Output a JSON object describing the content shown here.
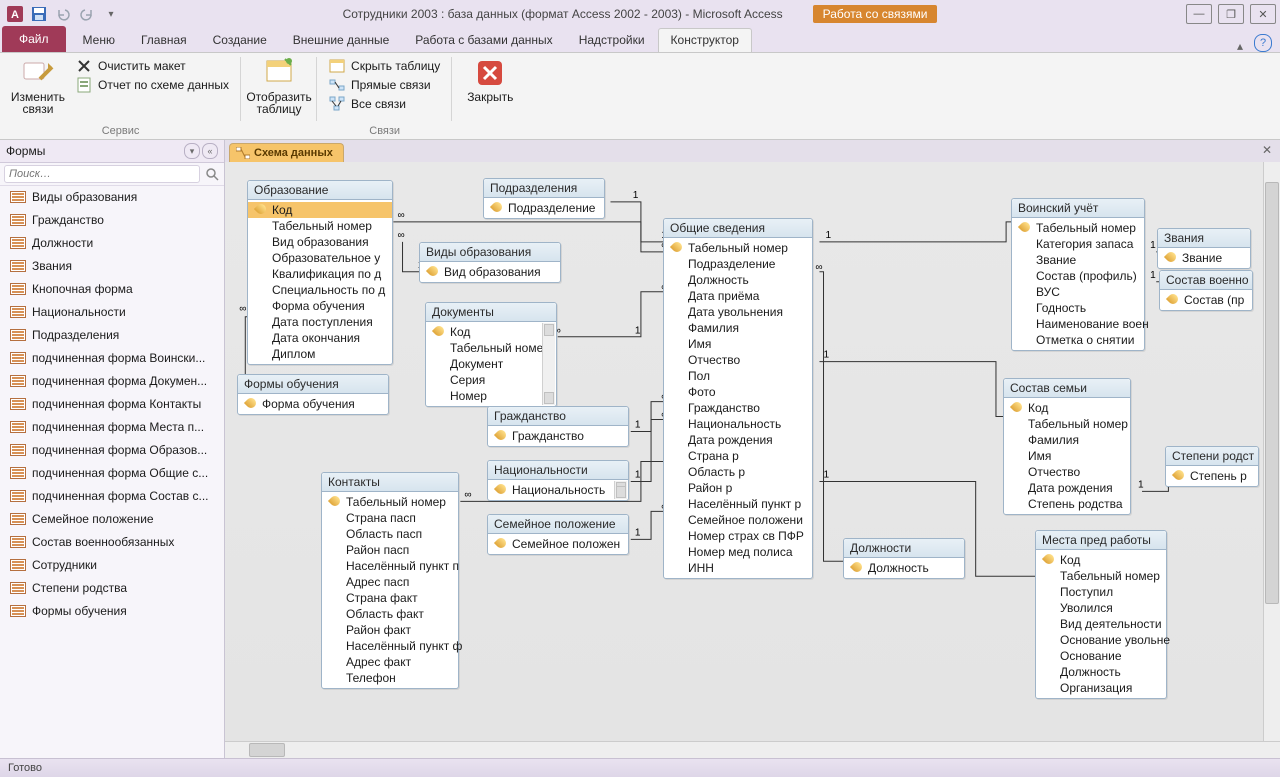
{
  "titlebar": {
    "title": "Сотрудники 2003 : база данных (формат Access 2002 - 2003)  -  Microsoft Access",
    "context_label": "Работа со связями"
  },
  "tabs": {
    "file": "Файл",
    "items": [
      "Меню",
      "Главная",
      "Создание",
      "Внешние данные",
      "Работа с базами данных",
      "Надстройки",
      "Конструктор"
    ],
    "active_index": 6
  },
  "ribbon": {
    "group1": {
      "title": "Сервис",
      "edit_rel": "Изменить связи",
      "clear_layout": "Очистить макет",
      "rel_report": "Отчет по схеме данных"
    },
    "group2": {
      "title": "",
      "show_table": "Отобразить таблицу"
    },
    "group3": {
      "title": "Связи",
      "hide_table": "Скрыть таблицу",
      "direct_rel": "Прямые связи",
      "all_rel": "Все связи"
    },
    "group4": {
      "close": "Закрыть"
    }
  },
  "nav": {
    "header": "Формы",
    "search_placeholder": "Поиск…",
    "items": [
      "Виды образования",
      "Гражданство",
      "Должности",
      "Звания",
      "Кнопочная форма",
      "Национальности",
      "Подразделения",
      "подчиненная форма Воински...",
      "подчиненная форма Докумен...",
      "подчиненная форма Контакты",
      "подчиненная форма Места п...",
      "подчиненная форма Образов...",
      "подчиненная форма Общие с...",
      "подчиненная форма Состав с...",
      "Семейное положение",
      "Состав военнообязанных",
      "Сотрудники",
      "Степени родства",
      "Формы обучения"
    ]
  },
  "doc_tab": {
    "label": "Схема данных"
  },
  "tables": {
    "edu": {
      "head": "Образование",
      "fields": [
        "Код",
        "Табельный номер",
        "Вид образования",
        "Образовательное у",
        "Квалификация по д",
        "Специальность по д",
        "Форма обучения",
        "Дата поступления",
        "Дата окончания",
        "Диплом"
      ],
      "pk": [
        0
      ],
      "sel": [
        0
      ]
    },
    "edu_kind": {
      "head": "Виды образования",
      "fields": [
        "Вид образования"
      ],
      "pk": [
        0
      ]
    },
    "docs": {
      "head": "Документы",
      "fields": [
        "Код",
        "Табельный номер",
        "Документ",
        "Серия",
        "Номер"
      ],
      "pk": [
        0
      ]
    },
    "edu_form": {
      "head": "Формы обучения",
      "fields": [
        "Форма обучения"
      ],
      "pk": [
        0
      ]
    },
    "citiz": {
      "head": "Гражданство",
      "fields": [
        "Гражданство"
      ],
      "pk": [
        0
      ]
    },
    "nation": {
      "head": "Национальности",
      "fields": [
        "Национальность"
      ],
      "pk": [
        0
      ]
    },
    "marital": {
      "head": "Семейное положение",
      "fields": [
        "Семейное положен"
      ],
      "pk": [
        0
      ]
    },
    "contacts": {
      "head": "Контакты",
      "fields": [
        "Табельный номер",
        "Страна пасп",
        "Область пасп",
        "Район пасп",
        "Населённый пункт п",
        "Адрес пасп",
        "Страна факт",
        "Область факт",
        "Район факт",
        "Населённый пункт ф",
        "Адрес факт",
        "Телефон"
      ],
      "pk": [
        0
      ]
    },
    "depts": {
      "head": "Подразделения",
      "fields": [
        "Подразделение"
      ],
      "pk": [
        0
      ]
    },
    "common": {
      "head": "Общие сведения",
      "fields": [
        "Табельный номер",
        "Подразделение",
        "Должность",
        "Дата приёма",
        "Дата увольнения",
        "Фамилия",
        "Имя",
        "Отчество",
        "Пол",
        "Фото",
        "Гражданство",
        "Национальность",
        "Дата рождения",
        "Страна р",
        "Область р",
        "Район р",
        "Населённый пункт р",
        "Семейное положени",
        "Номер страх св ПФР",
        "Номер мед полиса",
        "ИНН"
      ],
      "pk": [
        0
      ]
    },
    "positions": {
      "head": "Должности",
      "fields": [
        "Должность"
      ],
      "pk": [
        0
      ]
    },
    "military": {
      "head": "Воинский учёт",
      "fields": [
        "Табельный номер",
        "Категория запаса",
        "Звание",
        "Состав (профиль)",
        "ВУС",
        "Годность",
        "Наименование воен",
        "Отметка о снятии"
      ],
      "pk": [
        0
      ]
    },
    "ranks": {
      "head": "Звания",
      "fields": [
        "Звание"
      ],
      "pk": [
        0
      ]
    },
    "milstaff": {
      "head": "Состав военно",
      "fields": [
        "Состав (пр"
      ],
      "pk": [
        0
      ]
    },
    "family": {
      "head": "Состав семьи",
      "fields": [
        "Код",
        "Табельный номер",
        "Фамилия",
        "Имя",
        "Отчество",
        "Дата рождения",
        "Степень родства"
      ],
      "pk": [
        0
      ]
    },
    "kinship": {
      "head": "Степени родст",
      "fields": [
        "Степень р"
      ],
      "pk": [
        0
      ]
    },
    "jobs": {
      "head": "Места пред работы",
      "fields": [
        "Код",
        "Табельный номер",
        "Поступил",
        "Уволился",
        "Вид деятельности",
        "Основание увольне",
        "Основание",
        "Должность",
        "Организация"
      ],
      "pk": [
        0
      ]
    }
  },
  "status": "Готово"
}
